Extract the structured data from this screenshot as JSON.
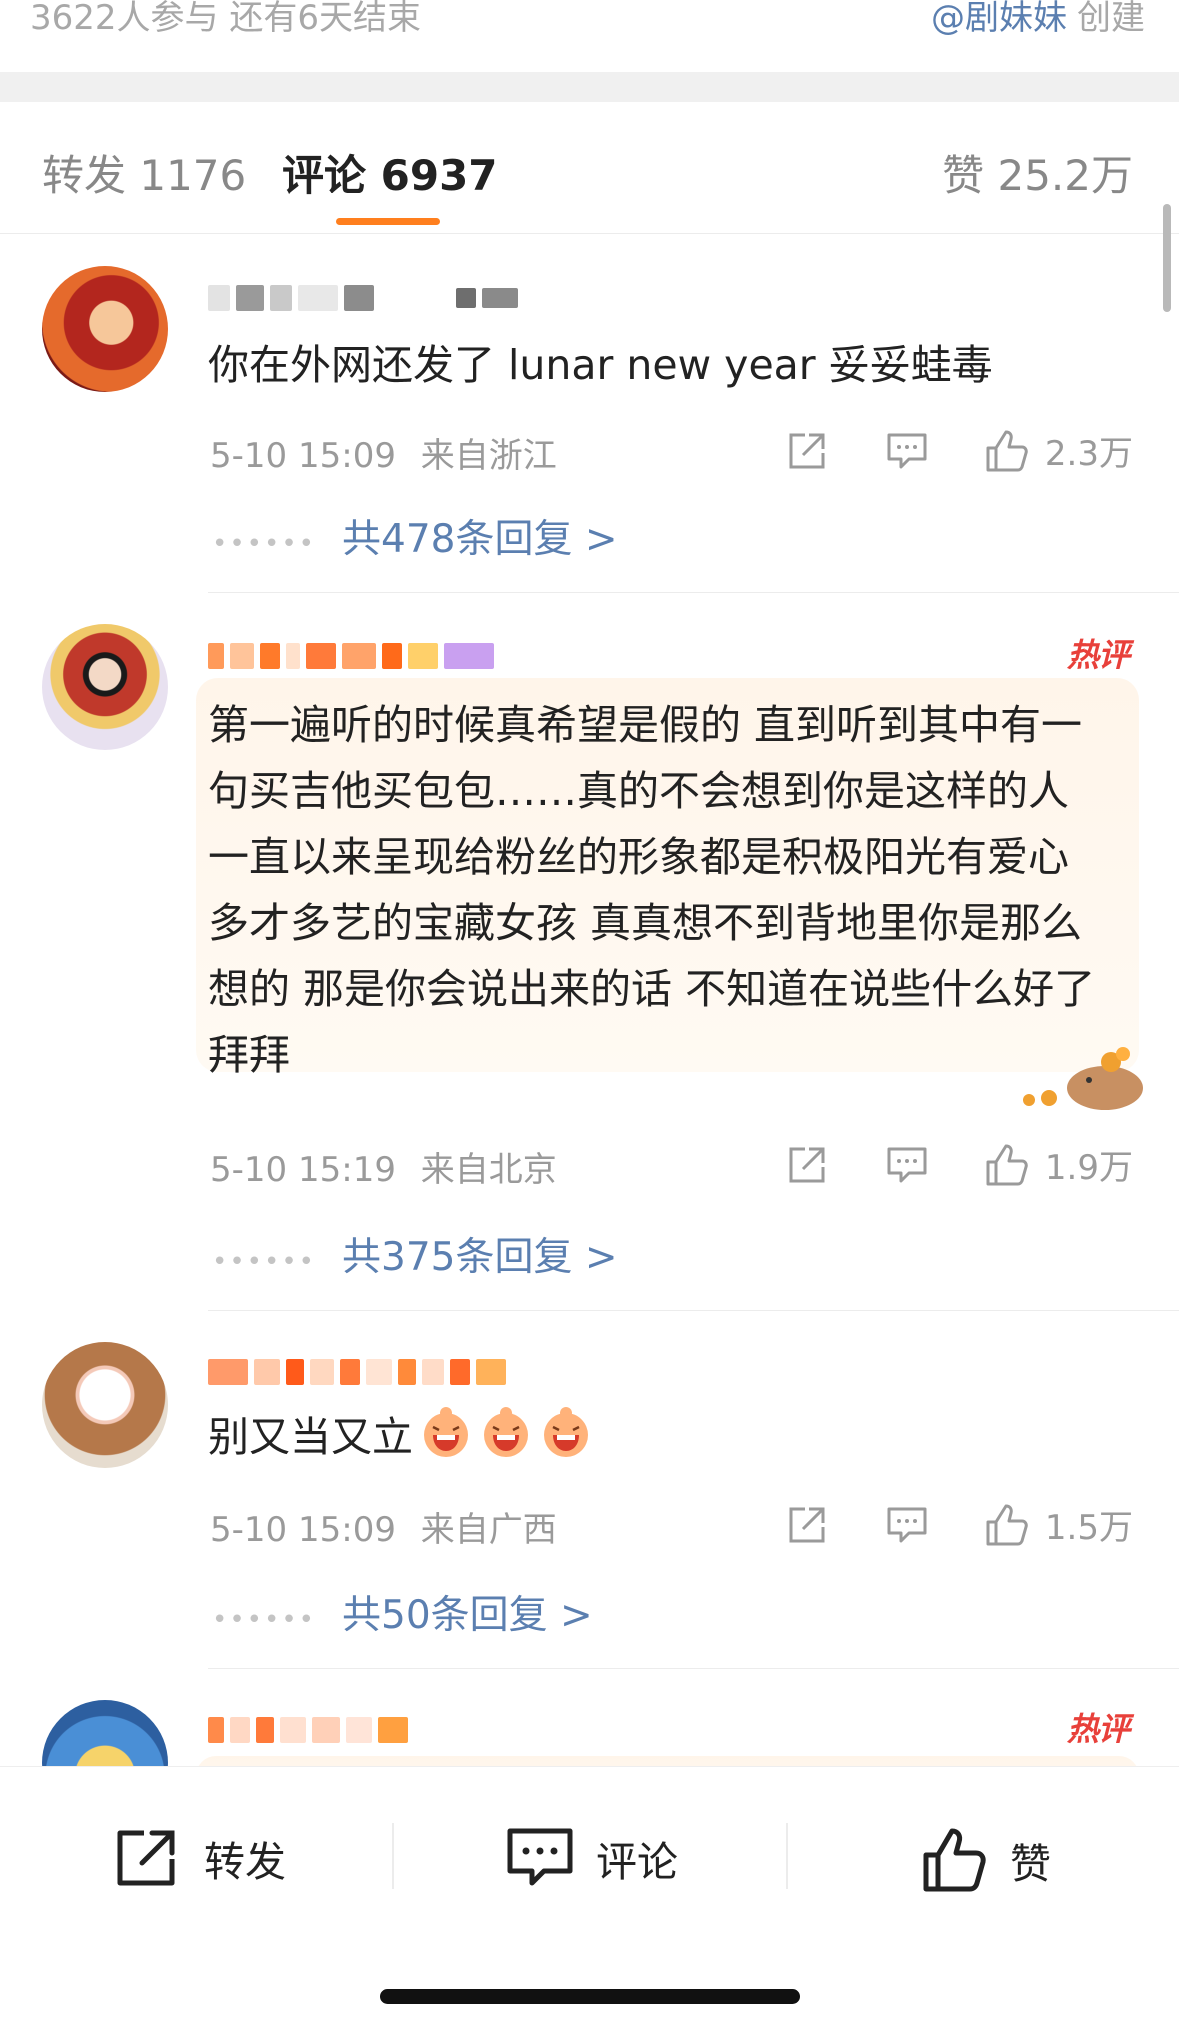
{
  "header": {
    "participants_text": "3622人参与 还有6天结束",
    "creator_handle": "@剧妹妹",
    "creator_suffix": "创建"
  },
  "tabs": {
    "forward": "转发 1176",
    "comments": "评论 6937",
    "likes": "赞 25.2万"
  },
  "comments": [
    {
      "text": "你在外网还发了 lunar new year 妥妥蛙毒",
      "time": "5-10 15:09",
      "location": "来自浙江",
      "likes": "2.3万",
      "replies": "共478条回复 >",
      "hot": false
    },
    {
      "text": "第一遍听的时候真希望是假的 直到听到其中有一句买吉他买包包……真的不会想到你是这样的人 一直以来呈现给粉丝的形象都是积极阳光有爱心 多才多艺的宝藏女孩 真真想不到背地里你是那么想的 那是你会说出来的话 不知道在说些什么好了 拜拜",
      "time": "5-10 15:19",
      "location": "来自北京",
      "likes": "1.9万",
      "replies": "共375条回复 >",
      "hot": true,
      "hot_label": "热评"
    },
    {
      "text": "别又当又立",
      "time": "5-10 15:09",
      "location": "来自广西",
      "likes": "1.5万",
      "replies": "共50条回复 >",
      "hot": false
    },
    {
      "hot": true,
      "hot_label": "热评"
    }
  ],
  "bottom_bar": {
    "forward": "转发",
    "comment": "评论",
    "like": "赞"
  },
  "colors": {
    "accent": "#ff7f1e",
    "link": "#5b7fb0",
    "hot": "#e8403a"
  }
}
